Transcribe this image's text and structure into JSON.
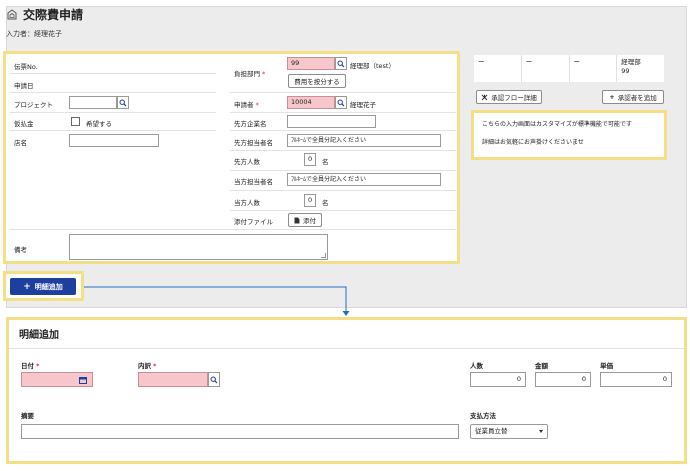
{
  "header": {
    "title": "交際費申請",
    "entered_by": "入力者：経理花子"
  },
  "form": {
    "slip_no_label": "伝票No.",
    "apply_date_label": "申請日",
    "project_label": "プロジェクト",
    "advance_label": "仮払金",
    "advance_checkbox_label": "希望する",
    "store_label": "店名",
    "note_label": "備考",
    "dept_label": "負担部門",
    "dept_code": "99",
    "dept_name": "経理部（test）",
    "split_button": "費用を按分する",
    "applicant_label": "申請者",
    "applicant_code": "10004",
    "applicant_name": "経理花子",
    "partner_company_label": "先方企業名",
    "partner_person_label": "先方担当者名",
    "partner_person_value": "ﾌﾙﾈｰﾑで全員分記入ください",
    "partner_count_label": "先方人数",
    "partner_count_value": "0",
    "partner_count_unit": "名",
    "our_person_label": "当方担当者名",
    "our_person_value": "ﾌﾙﾈｰﾑで全員分記入ください",
    "our_count_label": "当方人数",
    "our_count_value": "0",
    "our_count_unit": "名",
    "attachment_label": "添付ファイル",
    "attach_button": "添付"
  },
  "approvers": {
    "cells": [
      "ー",
      "ー",
      "ー",
      "経理部\n99"
    ],
    "flow_detail_button": "承認フロー詳細",
    "add_approver_button": "承認者を追加"
  },
  "info": {
    "line1": "こちらの入力画面はカスタマイズが標準機能で可能です",
    "line2": "詳細はお気軽にお声掛けくださいませ"
  },
  "add_detail_button": "明細追加",
  "detail": {
    "title": "明細追加",
    "date_label": "日付",
    "breakdown_label": "内訳",
    "people_label": "人数",
    "people_value": "0",
    "amount_label": "金額",
    "amount_value": "0",
    "unit_price_label": "単価",
    "unit_price_value": "0",
    "summary_label": "摘要",
    "payment_label": "支払方法",
    "payment_value": "従業員立替"
  },
  "colors": {
    "highlight": "#f5df86",
    "required_field": "#f7c6cb",
    "primary_button": "#1d3f9e",
    "connector": "#1f6fc1"
  }
}
